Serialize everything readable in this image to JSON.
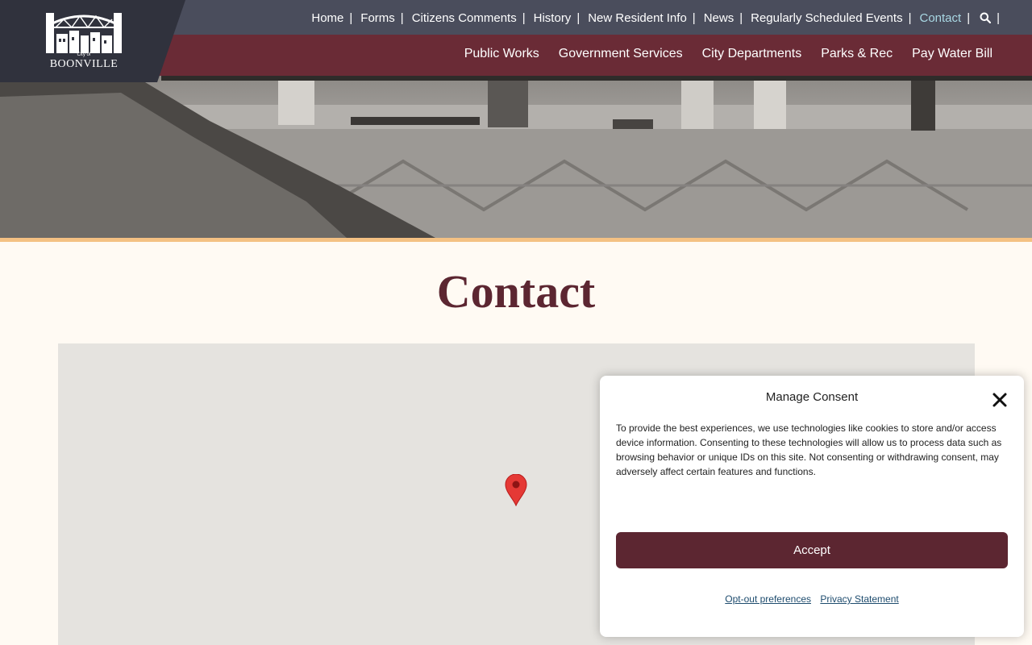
{
  "colors": {
    "top_bar": "#4a4d5c",
    "main_bar": "#6a2b36",
    "logo_panel": "#30323d",
    "accent_stripe": "#f4c183",
    "page_background": "#fffaf3",
    "title": "#5c2631",
    "active_link": "#a9d8e4",
    "accept_button": "#5c2631",
    "map_background": "#e5e3df",
    "pin": "#e53935"
  },
  "logo": {
    "small_text": "City of",
    "name": "BOONVILLE",
    "icon": "bridge-town-logo"
  },
  "top_nav": {
    "items": [
      {
        "label": "Home"
      },
      {
        "label": "Forms"
      },
      {
        "label": "Citizens Comments"
      },
      {
        "label": "History"
      },
      {
        "label": "New Resident Info"
      },
      {
        "label": "News"
      },
      {
        "label": "Regularly Scheduled Events"
      },
      {
        "label": "Contact",
        "active": true
      }
    ],
    "separator": "|",
    "search_icon": "search-icon"
  },
  "main_nav": {
    "items": [
      {
        "label": "Public Works"
      },
      {
        "label": "Government Services"
      },
      {
        "label": "City Departments"
      },
      {
        "label": "Parks & Rec"
      },
      {
        "label": "Pay Water Bill"
      }
    ]
  },
  "page": {
    "title": "Contact"
  },
  "map": {
    "marker_icon": "map-pin-icon"
  },
  "consent": {
    "title": "Manage Consent",
    "close_icon": "close-icon",
    "body": "To provide the best experiences, we use technologies like cookies to store and/or access device information. Consenting to these technologies will allow us to process data such as browsing behavior or unique IDs on this site. Not consenting or withdrawing consent, may adversely affect certain features and functions.",
    "accept_label": "Accept",
    "links": {
      "opt_out": "Opt-out preferences",
      "privacy": "Privacy Statement"
    }
  }
}
